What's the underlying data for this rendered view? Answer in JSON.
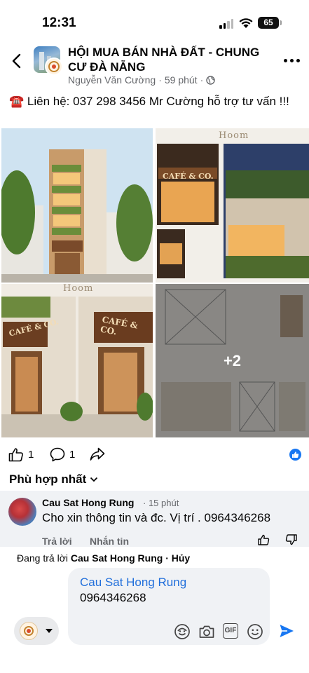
{
  "status_bar": {
    "time": "12:31",
    "battery": "65"
  },
  "header": {
    "group_title": "HỘI MUA BÁN NHÀ ĐẤT - CHUNG CƯ ĐÀ NẴNG",
    "author": "Nguyễn Văn Cường",
    "time": "59 phút",
    "separator": "·"
  },
  "post": {
    "phone_emoji": "☎️",
    "text": "Liên hệ: 037 298 3456 Mr Cường hỗ trợ tư vấn !!!"
  },
  "photos": {
    "cafe_sign": "CAFÉ & CO.",
    "watermark": "Hoom",
    "more_count": "+2"
  },
  "actions": {
    "likes": "1",
    "comments": "1"
  },
  "sort_label": "Phù hợp nhất",
  "comment": {
    "name": "Cau Sat Hong Rung",
    "time": "· 15 phút",
    "text": "Cho xin thông tin và đc. Vị trí . 0964346268",
    "reply_label": "Trả lời",
    "message_label": "Nhắn tin"
  },
  "composer": {
    "replying_prefix": "Đang trả lời",
    "replying_to": "Cau Sat Hong Rung",
    "cancel": "· Hủy",
    "mention": "Cau Sat Hong Rung",
    "typed_text": "0964346268",
    "gif_label": "GIF"
  },
  "colors": {
    "accent": "#1877f2",
    "mention": "#216fdb",
    "secondary_text": "#65676b",
    "comment_bg": "#f0f2f5"
  }
}
